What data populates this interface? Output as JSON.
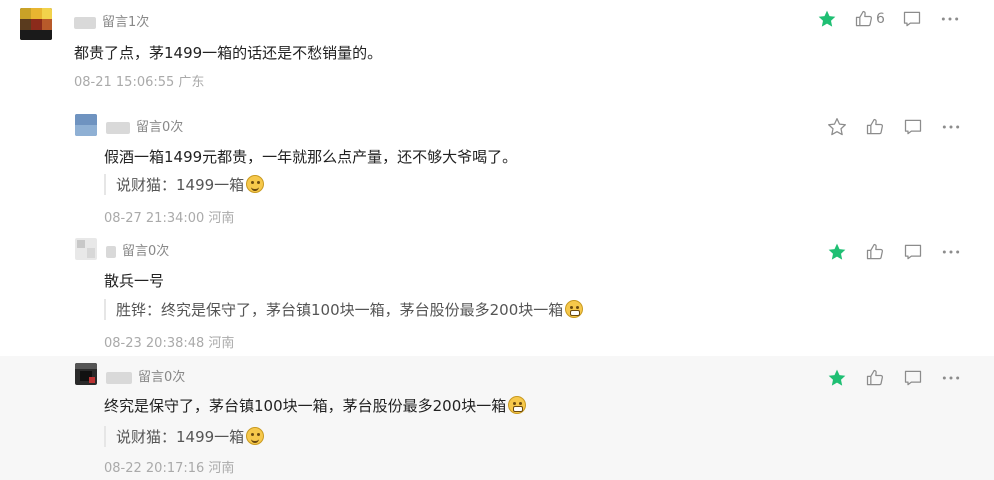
{
  "comments": [
    {
      "user_count": "留言1次",
      "text": "都贵了点，茅1499一箱的话还是不愁销量的。",
      "meta": "08-21 15:06:55 广东",
      "likes": "6",
      "starred": true
    },
    {
      "user_count": "留言0次",
      "text": "假酒一箱1499元都贵，一年就那么点产量，还不够大爷喝了。",
      "quote": "说财猫：1499一箱",
      "meta": "08-27 21:34:00 河南",
      "starred": false
    },
    {
      "user_count": "留言0次",
      "text": "散兵一号",
      "quote": "胜铧：终究是保守了，茅台镇100块一箱，茅台股份最多200块一箱",
      "meta": "08-23 20:38:48 河南",
      "starred": true
    },
    {
      "user_count": "留言0次",
      "text": "终究是保守了，茅台镇100块一箱，茅台股份最多200块一箱",
      "quote": "说财猫：1499一箱",
      "meta": "08-22 20:17:16 河南",
      "starred": true
    }
  ],
  "colors": {
    "star_active": "#1fbf73",
    "icon_gray": "#8c8c8c"
  }
}
